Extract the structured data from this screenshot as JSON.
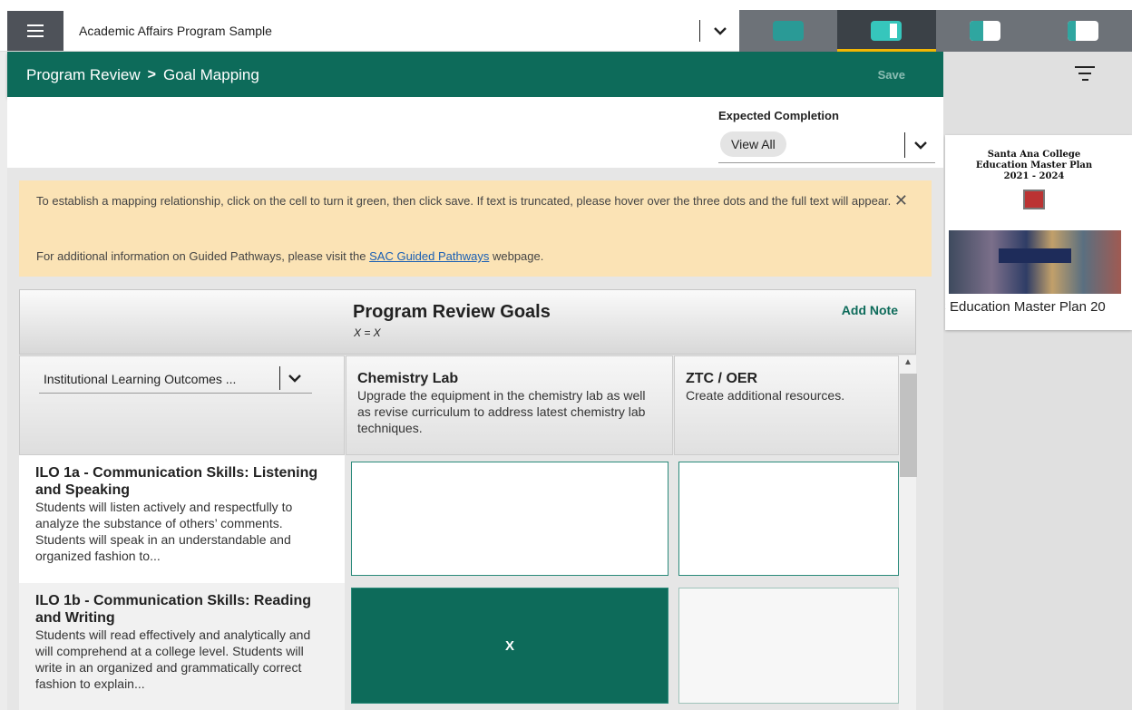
{
  "topbar": {
    "app_title": "Academic Affairs Program Sample",
    "view_modes": [
      "full-view",
      "split-view",
      "half-view",
      "side-view"
    ]
  },
  "header": {
    "breadcrumb_parent": "Program Review",
    "breadcrumb_separator": ">",
    "breadcrumb_current": "Goal Mapping",
    "save_label": "Save"
  },
  "filter": {
    "label": "Expected Completion",
    "value": "View All"
  },
  "notice": {
    "line1": "To establish a mapping relationship, click on the cell to turn it green, then click save. If text is truncated, please hover over the three dots and the full text will appear.",
    "line2_prefix": "For additional information on Guided Pathways, please visit the",
    "link_text": "SAC Guided Pathways",
    "line2_suffix": "webpage.",
    "close_glyph": "✕"
  },
  "grid": {
    "title": "Program Review Goals",
    "subtitle": "X = X",
    "add_note_label": "Add Note",
    "row_selector": "Institutional Learning Outcomes ...",
    "columns": [
      {
        "title": "Chemistry Lab",
        "desc": "Upgrade the equipment in the chemistry lab as well as revise curriculum to address latest chemistry lab techniques."
      },
      {
        "title": "ZTC / OER",
        "desc": "Create additional resources."
      }
    ],
    "rows": [
      {
        "title": "ILO 1a - Communication Skills: Listening and Speaking",
        "desc": "Students will listen actively and respectfully to analyze the substance of others’ comments. Students will speak in an understandable and organized fashion to..."
      },
      {
        "title": "ILO 1b - Communication Skills: Reading and Writing",
        "desc": "Students will read effectively and analytically and will comprehend at a college level. Students will write in an organized and grammatically correct fashion to explain..."
      }
    ],
    "mapped_cell_mark": "X"
  },
  "side_panel": {
    "doc_cover_title_1": "Santa Ana College",
    "doc_cover_title_2": "Education Master Plan",
    "doc_cover_years": "2021 - 2024",
    "doc_label": "C Education Master Plan 20"
  },
  "colors": {
    "brand_green": "#0d6b5a",
    "notice_bg": "#fbe3b5",
    "active_view_underline": "#f2b705"
  }
}
